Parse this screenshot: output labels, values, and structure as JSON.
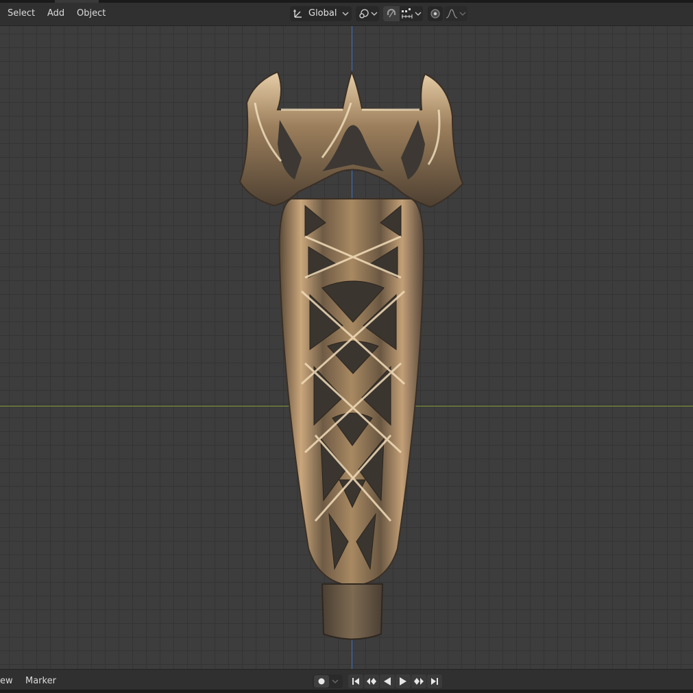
{
  "header": {
    "menus": [
      "Select",
      "Add",
      "Object"
    ],
    "transform_orientation": "Global"
  },
  "footer": {
    "menus": [
      "ew",
      "Marker"
    ]
  },
  "icons": {
    "orientation": "transform-orientation-icon",
    "pivot": "pivot-point-icon",
    "snap": "snap-magnet-icon",
    "snap_increment": "snap-increment-icon",
    "proportional": "proportional-editing-icon",
    "falloff": "falloff-curve-icon",
    "record": "record-keyframe-icon",
    "jump_start": "jump-start-icon",
    "prev_key": "prev-keyframe-icon",
    "play_reverse": "play-reverse-icon",
    "play": "play-icon",
    "next_key": "next-keyframe-icon",
    "jump_end": "jump-end-icon"
  },
  "colors": {
    "grid_bg": "#3d3d3d",
    "x_axis": "#7d9a37",
    "z_axis": "#3f6fc7",
    "model": "#8b7356"
  }
}
